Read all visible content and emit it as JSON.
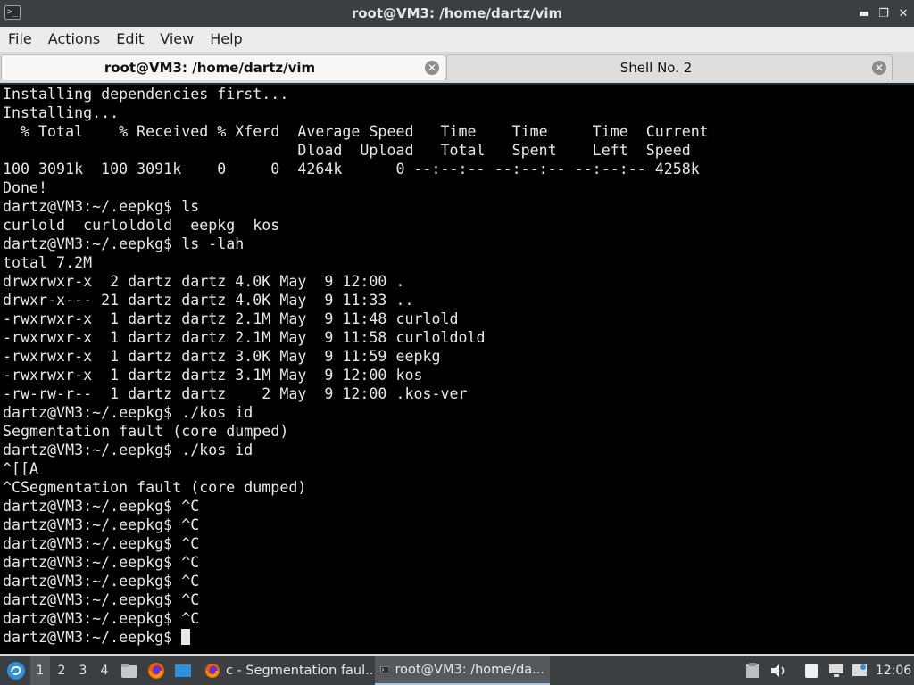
{
  "window": {
    "title": "root@VM3: /home/dartz/vim",
    "controls": {
      "minimize": "▬",
      "restore": "❐",
      "close": "✕"
    }
  },
  "menu": [
    "File",
    "Actions",
    "Edit",
    "View",
    "Help"
  ],
  "tabs": [
    {
      "label": "root@VM3: /home/dartz/vim",
      "active": true
    },
    {
      "label": "Shell No. 2",
      "active": false
    }
  ],
  "terminal": {
    "lines": [
      "Installing dependencies first...",
      "Installing...",
      "  % Total    % Received % Xferd  Average Speed   Time    Time     Time  Current",
      "                                 Dload  Upload   Total   Spent    Left  Speed",
      "100 3091k  100 3091k    0     0  4264k      0 --:--:-- --:--:-- --:--:-- 4258k",
      "Done!",
      "dartz@VM3:~/.eepkg$ ls",
      "curlold  curloldold  eepkg  kos",
      "dartz@VM3:~/.eepkg$ ls -lah",
      "total 7.2M",
      "drwxrwxr-x  2 dartz dartz 4.0K May  9 12:00 .",
      "drwxr-x--- 21 dartz dartz 4.0K May  9 11:33 ..",
      "-rwxrwxr-x  1 dartz dartz 2.1M May  9 11:48 curlold",
      "-rwxrwxr-x  1 dartz dartz 2.1M May  9 11:58 curloldold",
      "-rwxrwxr-x  1 dartz dartz 3.0K May  9 11:59 eepkg",
      "-rwxrwxr-x  1 dartz dartz 3.1M May  9 12:00 kos",
      "-rw-rw-r--  1 dartz dartz    2 May  9 12:00 .kos-ver",
      "dartz@VM3:~/.eepkg$ ./kos id",
      "Segmentation fault (core dumped)",
      "dartz@VM3:~/.eepkg$ ./kos id",
      "^[[A",
      "^CSegmentation fault (core dumped)",
      "dartz@VM3:~/.eepkg$ ^C",
      "dartz@VM3:~/.eepkg$ ^C",
      "dartz@VM3:~/.eepkg$ ^C",
      "dartz@VM3:~/.eepkg$ ^C",
      "dartz@VM3:~/.eepkg$ ^C",
      "dartz@VM3:~/.eepkg$ ^C",
      "dartz@VM3:~/.eepkg$ ^C"
    ],
    "prompt": "dartz@VM3:~/.eepkg$ "
  },
  "taskbar": {
    "workspaces": [
      "1",
      "2",
      "3",
      "4"
    ],
    "active_workspace": "1",
    "tasks": [
      {
        "label": "c - Segmentation faul...",
        "icon": "firefox-icon"
      },
      {
        "label": "root@VM3: /home/da...",
        "icon": "terminal-icon",
        "active": true
      }
    ],
    "clock": "12:06"
  },
  "colors": {
    "titlebar": "#3b3f42",
    "terminal_bg": "#000000",
    "terminal_fg": "#e8e8e8",
    "accent": "#9ec7ee"
  }
}
